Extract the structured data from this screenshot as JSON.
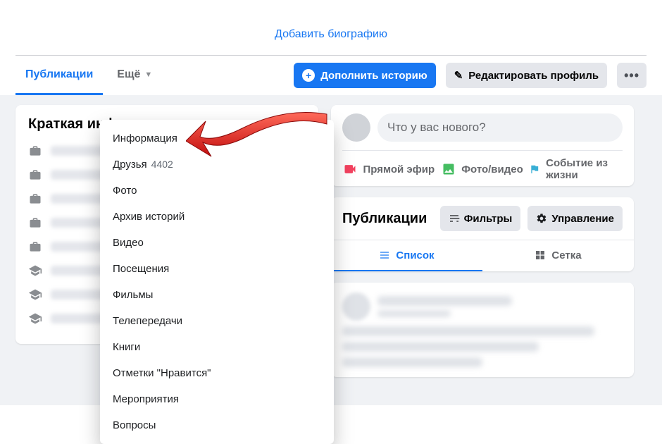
{
  "bio": {
    "add_bio": "Добавить биографию"
  },
  "tabs": {
    "publications": "Публикации",
    "more": "Ещё"
  },
  "actions": {
    "add_story": "Дополнить историю",
    "edit_profile": "Редактировать профиль"
  },
  "intro": {
    "title": "Краткая информация"
  },
  "create_post": {
    "placeholder": "Что у вас нового?",
    "live": "Прямой эфир",
    "photo_video": "Фото/видео",
    "life_event": "Событие из жизни"
  },
  "posts": {
    "header": "Публикации",
    "filters": "Фильтры",
    "manage": "Управление",
    "list": "Список",
    "grid": "Сетка"
  },
  "dropdown": {
    "items": [
      {
        "label": "Информация"
      },
      {
        "label": "Друзья",
        "count": "4402"
      },
      {
        "label": "Фото"
      },
      {
        "label": "Архив историй"
      },
      {
        "label": "Видео"
      },
      {
        "label": "Посещения"
      },
      {
        "label": "Фильмы"
      },
      {
        "label": "Телепередачи"
      },
      {
        "label": "Книги"
      },
      {
        "label": "Отметки \"Нравится\""
      },
      {
        "label": "Мероприятия"
      },
      {
        "label": "Вопросы"
      }
    ]
  }
}
